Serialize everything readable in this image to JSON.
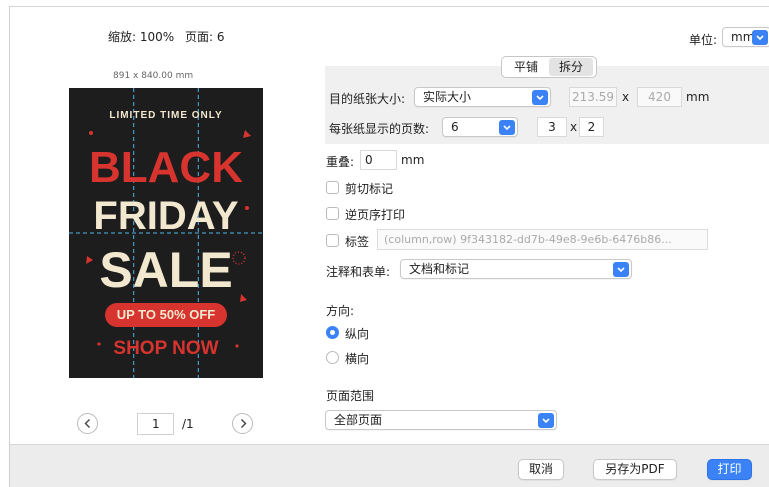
{
  "header": {
    "zoom_label": "缩放: 100%",
    "page_label": "页面: 6",
    "unit_label": "单位:",
    "unit_value": "mm"
  },
  "preview": {
    "size_label": "891 x 840.00 mm",
    "poster": {
      "top_arc": "LIMITED TIME ONLY",
      "line1": "BLACK",
      "line2": "FRIDAY",
      "line3": "SALE",
      "badge": "UP TO 50% OFF",
      "cta": "SHOP NOW"
    },
    "pager": {
      "current": "1",
      "total": "/1"
    }
  },
  "mode_tabs": [
    {
      "label": "平铺"
    },
    {
      "label": "拆分"
    }
  ],
  "paper": {
    "label": "目的纸张大小:",
    "value": "实际大小",
    "width": "213.59",
    "x": "x",
    "height": "420",
    "unit": "mm"
  },
  "pages_per_sheet": {
    "label": "每张纸显示的页数:",
    "value": "6",
    "cols": "3",
    "x": "x",
    "rows": "2"
  },
  "overlap": {
    "label": "重叠:",
    "value": "0",
    "unit": "mm"
  },
  "checkboxes": {
    "crop_marks": "剪切标记",
    "reverse_order": "逆页序打印",
    "labels": "标签",
    "labels_placeholder": "(column,row) 9f343182-dd7b-49e8-9e6b-6476b86..."
  },
  "annotations": {
    "label": "注释和表单:",
    "value": "文档和标记"
  },
  "orientation": {
    "label": "方向:",
    "portrait": "纵向",
    "landscape": "横向"
  },
  "page_range": {
    "label": "页面范围",
    "value": "全部页面"
  },
  "footer": {
    "cancel": "取消",
    "save_pdf": "另存为PDF",
    "print": "打印"
  },
  "colors": {
    "accent": "#3a82f6",
    "poster_bg": "#1d1d1d",
    "poster_red": "#d7342f",
    "poster_cream": "#f2e8cf",
    "guide": "#4fb5e8"
  },
  "icons": [
    "chevron-down-icon",
    "chevron-left-icon",
    "chevron-right-icon",
    "radio-selected-icon"
  ]
}
